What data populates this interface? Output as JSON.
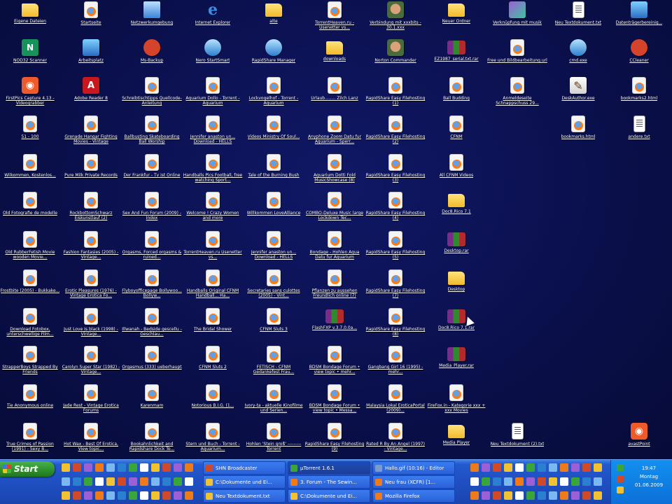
{
  "desktop": {
    "icons": [
      {
        "label": "Eigene Dateien",
        "type": "folder"
      },
      {
        "label": "Startseite",
        "type": "html"
      },
      {
        "label": "Netzwerkumgebung",
        "type": "net"
      },
      {
        "label": "Internet Explorer",
        "type": "ie"
      },
      {
        "label": "alte",
        "type": "folder"
      },
      {
        "label": "TorrentHeaven.ru - Usenetter vs...",
        "type": "html"
      },
      {
        "label": "Verbindung mit xxxbits - 30.1.xxx",
        "type": "face"
      },
      {
        "label": "Neuer Ordner",
        "type": "folder"
      },
      {
        "label": "Verknüpfung mit musik",
        "type": "music"
      },
      {
        "label": "Neu Textdokument.txt",
        "type": "txt"
      },
      {
        "label": "Datenträgerbereinig...",
        "type": "app"
      },
      {
        "label": "NOD32 Scanner",
        "type": "green"
      },
      {
        "label": "Arbeitsplatz",
        "type": "app"
      },
      {
        "label": "Ms-Backup",
        "type": "red"
      },
      {
        "label": "Nero StartSmart",
        "type": "av"
      },
      {
        "label": "RapidShare Manager",
        "type": "av"
      },
      {
        "label": "downloads",
        "type": "folder"
      },
      {
        "label": "Norton Commander",
        "type": "face"
      },
      {
        "label": "EZ1987_serial.txt.rar",
        "type": "rar"
      },
      {
        "label": "Free und Bildbearbeitung.url",
        "type": "html"
      },
      {
        "label": "cmd.exe",
        "type": "av"
      },
      {
        "label": "CCleaner",
        "type": "red"
      },
      {
        "label": "FirstPics Capture 4.13 - Videograbber",
        "type": "orange"
      },
      {
        "label": "Adobe Reader 8",
        "type": "pdf"
      },
      {
        "label": "Schreibtischtipps Quellcode-Anleitung",
        "type": "html"
      },
      {
        "label": "Aquarium Dollo - Torrent - Aquarium",
        "type": "html"
      },
      {
        "label": "Lockvogelhof - Torrent - Aquarium",
        "type": "html"
      },
      {
        "label": "Urlaub........ Zilch Lanz",
        "type": "html"
      },
      {
        "label": "RapidShare Easy Filehosting (1)",
        "type": "html"
      },
      {
        "label": "Ball Budding",
        "type": "html"
      },
      {
        "label": "Anmeldeseite Schnappschuss 29...",
        "type": "html"
      },
      {
        "label": "DeskAuthor.exe",
        "type": "pen"
      },
      {
        "label": "bookmarks2.html",
        "type": "html"
      },
      {
        "label": "51 - 100",
        "type": "html"
      },
      {
        "label": "Grenade Hangar Fighting Movies - Vintage",
        "type": "html"
      },
      {
        "label": "Ballbusting Skateboarding Ball Worship",
        "type": "html"
      },
      {
        "label": "Jennifer anaston un... Download - HELLS",
        "type": "html"
      },
      {
        "label": "Videos Ministry Of Soul...",
        "type": "html"
      },
      {
        "label": "Anyphone Zoom Datu fur Aquarium - Sperr...",
        "type": "html"
      },
      {
        "label": "RapidShare Easy Filehosting (2)",
        "type": "html"
      },
      {
        "label": "CFNM",
        "type": "html"
      },
      {
        "label": "bookmarks.html",
        "type": "html"
      },
      {
        "label": "andere.txt",
        "type": "txt"
      },
      {
        "label": "Wilkommen, Kostenlos...",
        "type": "html"
      },
      {
        "label": "Pure Milk Private Records",
        "type": "html"
      },
      {
        "label": "Der Frankfur - Tv ist Online",
        "type": "html"
      },
      {
        "label": "Handballs Pics Football, free watching Sport...",
        "type": "html"
      },
      {
        "label": "Tale of the Burning Bush",
        "type": "html"
      },
      {
        "label": "Aquarium Dotti Fold MusicShowcase (8)",
        "type": "html"
      },
      {
        "label": "RapidShare Easy Filehosting (3)",
        "type": "html"
      },
      {
        "label": "All CFNM Videos",
        "type": "html"
      },
      {
        "label": "Old Fotografie de modelle",
        "type": "html"
      },
      {
        "label": "RockbottomSchwarz Eiskunstlauf (2)",
        "type": "html"
      },
      {
        "label": "Sex And Fun Forum (2009) - Index",
        "type": "html"
      },
      {
        "label": "Welcome ! Crazy Women and more",
        "type": "html"
      },
      {
        "label": "Willkommen LoveAlliance",
        "type": "html"
      },
      {
        "label": "COMBO-Deluxe Music large Lockdown Tec...",
        "type": "html"
      },
      {
        "label": "RapidShare Easy Filehosting (4)",
        "type": "html"
      },
      {
        "label": "Doc8.Rico 7.1",
        "type": "folder"
      },
      {
        "label": "Old RubberFetish Movie wooden Movie...",
        "type": "html"
      },
      {
        "label": "Fashion Fantasies (2005) - Vintage...",
        "type": "html"
      },
      {
        "label": "Orgasms, Forced orgasms & ruined...",
        "type": "html"
      },
      {
        "label": "TorrentHeaven.ru Usenetter vs...",
        "type": "html"
      },
      {
        "label": "Jennifer anaston un... Download - HELLS",
        "type": "html"
      },
      {
        "label": "Bondage - Hohlen Aqua Datu fur Aquarium",
        "type": "html"
      },
      {
        "label": "RapidShare Easy Filehosting (5)",
        "type": "html"
      },
      {
        "label": "Desktop.rar",
        "type": "rar"
      },
      {
        "label": "Frostbite (2005) - Bukkake...",
        "type": "html"
      },
      {
        "label": "Erotic Pleasures (1976) - Vintage Erotica Fo...",
        "type": "html"
      },
      {
        "label": "Flyboyofficepage Bollywoo... Bollyw...",
        "type": "html"
      },
      {
        "label": "Handballs Original CFNM Handball... Ha...",
        "type": "html"
      },
      {
        "label": "Secretaries sans culottes (2005) - Vint...",
        "type": "html"
      },
      {
        "label": "Pflanzen zu aussehen Freundlich online (7)",
        "type": "html"
      },
      {
        "label": "RapidShare Easy Filehosting (7)",
        "type": "html"
      },
      {
        "label": "Desktop",
        "type": "folder"
      },
      {
        "label": "Download Fotobox, unterschwellige Film...",
        "type": "html"
      },
      {
        "label": "Just Love Is black (1998) - Vintage...",
        "type": "html"
      },
      {
        "label": "Illwanah - Bedside gescellu - Geschlau...",
        "type": "html"
      },
      {
        "label": "The Bridal Shower",
        "type": "html"
      },
      {
        "label": "CFNM Sluts 3",
        "type": "html"
      },
      {
        "label": "FlashFXP v.3.7.0.0a...",
        "type": "rar"
      },
      {
        "label": "RapidShare Easy Filehosting (8)",
        "type": "html"
      },
      {
        "label": "Doc8.Rico 7.1.rar",
        "type": "rar"
      },
      {
        "label": "StrapperBoys Strapped By Friends",
        "type": "html"
      },
      {
        "label": "Carolyn Super Star (1982) - Vintage...",
        "type": "html"
      },
      {
        "label": "Orgasmus (333) ueberhaupt",
        "type": "html"
      },
      {
        "label": "CFNM Sluts 2",
        "type": "html"
      },
      {
        "label": "FETISCH - CFNM Gedankefest Frau...",
        "type": "html"
      },
      {
        "label": "BDSM Bondage Forum • view topic • mehr...",
        "type": "html"
      },
      {
        "label": "Gangbang Girl 16 (1995) - mehr...",
        "type": "html"
      },
      {
        "label": "Media_Player.rar",
        "type": "rar"
      },
      {
        "label": "Tie Anonymous online",
        "type": "html"
      },
      {
        "label": "Jade Rest - Vintage Erotica Forums",
        "type": "html"
      },
      {
        "label": "Karenmam",
        "type": "html"
      },
      {
        "label": "Notorious B.I.G. (1...",
        "type": "html"
      },
      {
        "label": "Ivory-ta - aktuelle Kinofilme und Serien...",
        "type": "html"
      },
      {
        "label": "BDSM Bondage Forum • view topic • Messa...",
        "type": "html"
      },
      {
        "label": "Malaysia Lokal EroticaPortal (2009)...",
        "type": "html"
      },
      {
        "label": "FireFox.in - Kategorie xxx + xxx Movies",
        "type": "html"
      },
      {
        "label": "True Crimes of Passion (1991) - Sexy B...",
        "type": "html"
      },
      {
        "label": "Hot Wax - Best Of Erotica, View topic...",
        "type": "html"
      },
      {
        "label": "Bookahnlichkeit and Rapidshare Dock To...",
        "type": "html"
      },
      {
        "label": "Stern und Buch - Torrent - Aquarium...",
        "type": "html"
      },
      {
        "label": "Hohlen 'Stein groß' --------- Torrent",
        "type": "html"
      },
      {
        "label": "RapidShare Easy Filehosting (9)",
        "type": "html"
      },
      {
        "label": "Rated R By An Angel (1997) - Vintage...",
        "type": "html"
      },
      {
        "label": "Media Player",
        "type": "folder"
      },
      {
        "label": "Neu Textdokument (2).txt",
        "type": "txt"
      },
      {
        "label": "avastPoint",
        "type": "orange"
      }
    ]
  },
  "taskbar": {
    "start_label": "Start",
    "tasks": [
      {
        "label": "SHN Broadcaster",
        "active": false,
        "color": "#d04a2a"
      },
      {
        "label": "µTorrent 1.6.1",
        "active": true,
        "color": "#3aa63a"
      },
      {
        "label": "Hallo.gif (10:16) - Editor",
        "active": false,
        "color": "#7a9ad0"
      },
      {
        "label": "C:\\Dokumente und Ei...",
        "active": false,
        "color": "#f2c232"
      },
      {
        "label": "3. Forum - The Sewin...",
        "active": false,
        "color": "#ee7a1a"
      },
      {
        "label": "Neu frau (XCFR) [1...",
        "active": false,
        "color": "#ee7a1a"
      },
      {
        "label": "Neu Textdokument.txt",
        "active": false,
        "color": "#f2c232"
      },
      {
        "label": "C:\\Dokumente und Ei...",
        "active": false,
        "color": "#f2c232"
      },
      {
        "label": "Mozilla Firefox",
        "active": false,
        "color": "#ee7a1a"
      }
    ],
    "clock": {
      "time": "19:47",
      "day": "Montag",
      "date": "01.06.2009"
    }
  }
}
